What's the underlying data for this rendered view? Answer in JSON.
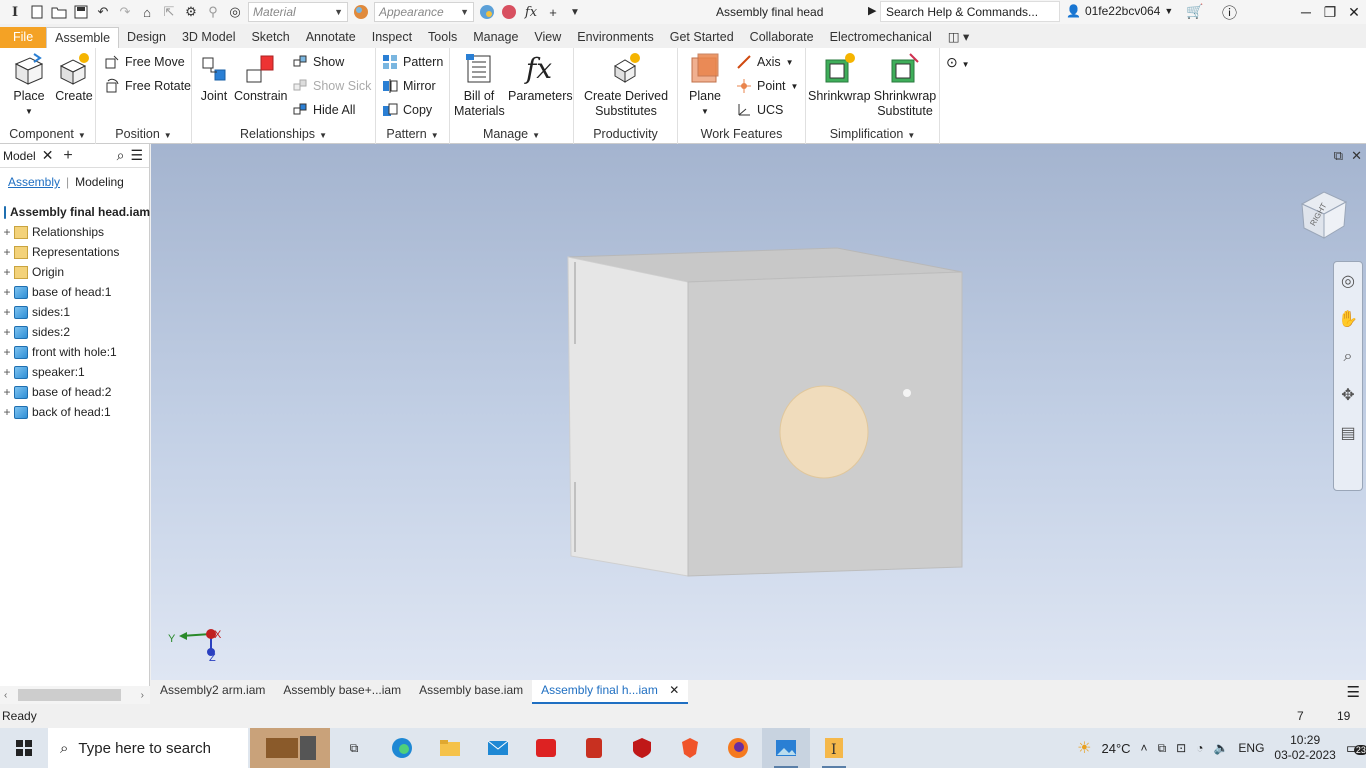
{
  "titlebar": {
    "material_placeholder": "Material",
    "appearance_placeholder": "Appearance",
    "doc_title": "Assembly final head",
    "search_placeholder": "Search Help & Commands...",
    "user": "01fe22bcv064"
  },
  "tabs": [
    "File",
    "Assemble",
    "Design",
    "3D Model",
    "Sketch",
    "Annotate",
    "Inspect",
    "Tools",
    "Manage",
    "View",
    "Environments",
    "Get Started",
    "Collaborate",
    "Electromechanical"
  ],
  "active_tab": "Assemble",
  "ribbon": {
    "component": {
      "label": "Component",
      "place": "Place",
      "create": "Create"
    },
    "position": {
      "label": "Position",
      "free_move": "Free Move",
      "free_rotate": "Free Rotate"
    },
    "relationships": {
      "label": "Relationships",
      "joint": "Joint",
      "constrain": "Constrain",
      "show": "Show",
      "show_sick": "Show Sick",
      "hide_all": "Hide All"
    },
    "pattern": {
      "label": "Pattern",
      "pattern": "Pattern",
      "mirror": "Mirror",
      "copy": "Copy"
    },
    "manage": {
      "label": "Manage",
      "bom_line1": "Bill of",
      "bom_line2": "Materials",
      "parameters": "Parameters"
    },
    "productivity": {
      "label": "Productivity",
      "line1": "Create Derived",
      "line2": "Substitutes"
    },
    "work_features": {
      "label": "Work Features",
      "plane": "Plane",
      "axis": "Axis",
      "point": "Point",
      "ucs": "UCS"
    },
    "simplification": {
      "label": "Simplification",
      "shrinkwrap": "Shrinkwrap",
      "sub_line1": "Shrinkwrap",
      "sub_line2": "Substitute"
    }
  },
  "browser": {
    "title": "Model",
    "tab_assembly": "Assembly",
    "tab_modeling": "Modeling",
    "root": "Assembly final head.iam",
    "items": [
      {
        "label": "Relationships",
        "icon": "folder"
      },
      {
        "label": "Representations",
        "icon": "folder"
      },
      {
        "label": "Origin",
        "icon": "folder"
      },
      {
        "label": "base of head:1",
        "icon": "part"
      },
      {
        "label": "sides:1",
        "icon": "part"
      },
      {
        "label": "sides:2",
        "icon": "part"
      },
      {
        "label": "front with hole:1",
        "icon": "part"
      },
      {
        "label": "speaker:1",
        "icon": "part"
      },
      {
        "label": "base of head:2",
        "icon": "part"
      },
      {
        "label": "back of head:1",
        "icon": "part"
      }
    ]
  },
  "viewcube": {
    "face": "RIGHT"
  },
  "triad": {
    "y": "Y",
    "x": "X",
    "z": "Z"
  },
  "doc_tabs": [
    {
      "label": "Assembly2 arm.iam",
      "active": false
    },
    {
      "label": "Assembly base+...iam",
      "active": false
    },
    {
      "label": "Assembly base.iam",
      "active": false
    },
    {
      "label": "Assembly final h...iam",
      "active": true
    }
  ],
  "status": {
    "text": "Ready",
    "num1": "7",
    "num2": "19"
  },
  "taskbar": {
    "search_placeholder": "Type here to search",
    "weather": "24°C",
    "lang": "ENG",
    "time": "10:29",
    "date": "03-02-2023",
    "notif_count": "23"
  }
}
